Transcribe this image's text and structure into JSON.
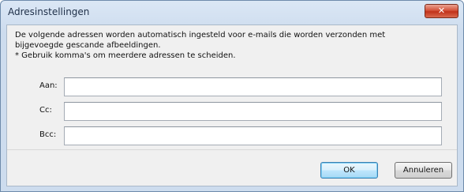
{
  "window": {
    "title": "Adresinstellingen",
    "close_label": "✕"
  },
  "description": {
    "line1": "De volgende adressen worden automatisch ingesteld voor e-mails die worden verzonden met",
    "line2": "bijgevoegde gescande afbeeldingen.",
    "note": "* Gebruik komma's om meerdere adressen te scheiden."
  },
  "fields": {
    "to": {
      "label": "Aan:",
      "value": ""
    },
    "cc": {
      "label": "Cc:",
      "value": ""
    },
    "bcc": {
      "label": "Bcc:",
      "value": ""
    }
  },
  "buttons": {
    "ok": "OK",
    "cancel": "Annuleren"
  },
  "colors": {
    "titlebar": "#cddcee",
    "close_button": "#c1321a",
    "content_background": "#f0f0f0"
  }
}
